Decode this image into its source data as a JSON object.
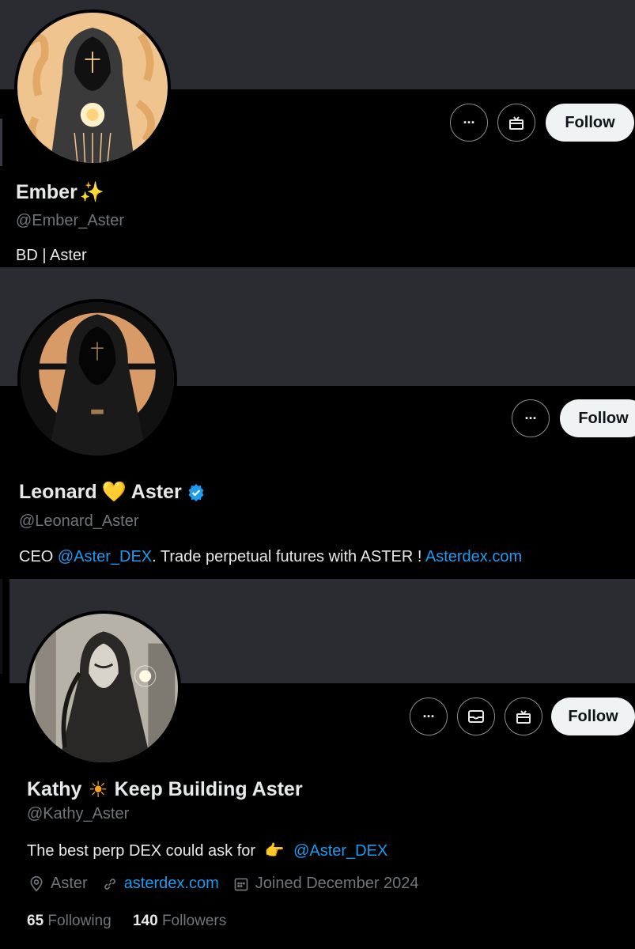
{
  "profiles": [
    {
      "name": "Ember",
      "name_emoji": "✨",
      "handle": "@Ember_Aster",
      "bio": "BD | Aster",
      "follow_label": "Follow",
      "more_label": "···"
    },
    {
      "name_part1": "Leonard",
      "heart": "💛",
      "name_part2": "Aster",
      "verified_icon": "verified-badge-icon",
      "handle": "@Leonard_Aster",
      "bio_prefix": "CEO ",
      "bio_mention": "@Aster_DEX",
      "bio_middle": ". Trade perpetual futures with ASTER ! ",
      "bio_link": "Asterdex.com",
      "follow_label": "Follow",
      "more_label": "···"
    },
    {
      "name_part1": "Kathy",
      "sun": "☀",
      "name_part2": "Keep Building Aster",
      "handle": "@Kathy_Aster",
      "bio_prefix": "The best perp DEX could ask for",
      "bio_emoji": "👉",
      "bio_mention": "@Aster_DEX",
      "location": "Aster",
      "website": "asterdex.com",
      "joined": "Joined December 2024",
      "following_count": "65",
      "following_label": "Following",
      "followers_count": "140",
      "followers_label": "Followers",
      "follow_label": "Follow",
      "more_label": "···"
    }
  ],
  "colors": {
    "banner": "#2b2c31",
    "background": "#000000",
    "link": "#1d9bf0",
    "muted": "#71767b",
    "text": "#e7e9ea",
    "follow_bg": "#eff3f4"
  }
}
